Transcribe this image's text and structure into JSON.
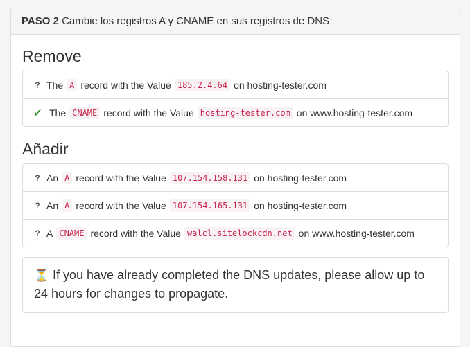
{
  "panel": {
    "step_label": "PASO 2",
    "heading_text": "Cambie los registros A y CNAME en sus registros de DNS"
  },
  "remove_section": {
    "title": "Remove",
    "items": [
      {
        "icon": "question-icon",
        "status_glyph": "?",
        "prefix": "The",
        "record_type": "A",
        "middle": "record with the Value",
        "value": "185.2.4.64",
        "suffix": "on hosting-tester.com"
      },
      {
        "icon": "check-icon",
        "status_glyph": "✔",
        "prefix": "The",
        "record_type": "CNAME",
        "middle": "record with the Value",
        "value": "hosting-tester.com",
        "suffix": "on www.hosting-tester.com"
      }
    ]
  },
  "add_section": {
    "title": "Añadir",
    "items": [
      {
        "icon": "question-icon",
        "status_glyph": "?",
        "prefix": "An",
        "record_type": "A",
        "middle": "record with the Value",
        "value": "107.154.158.131",
        "suffix": "on hosting-tester.com"
      },
      {
        "icon": "question-icon",
        "status_glyph": "?",
        "prefix": "An",
        "record_type": "A",
        "middle": "record with the Value",
        "value": "107.154.165.131",
        "suffix": "on hosting-tester.com"
      },
      {
        "icon": "question-icon",
        "status_glyph": "?",
        "prefix": "A",
        "record_type": "CNAME",
        "middle": "record with the Value",
        "value": "walcl.sitelockcdn.net",
        "suffix": "on www.hosting-tester.com"
      }
    ]
  },
  "notice": {
    "icon": "hourglass-icon",
    "text": "If you have already completed the DNS updates, please allow up to 24 hours for changes to propagate."
  },
  "colors": {
    "code_text": "#c7254e",
    "code_bg": "#f9f2f4",
    "success": "#3c9a3c",
    "border": "#dddddd"
  }
}
